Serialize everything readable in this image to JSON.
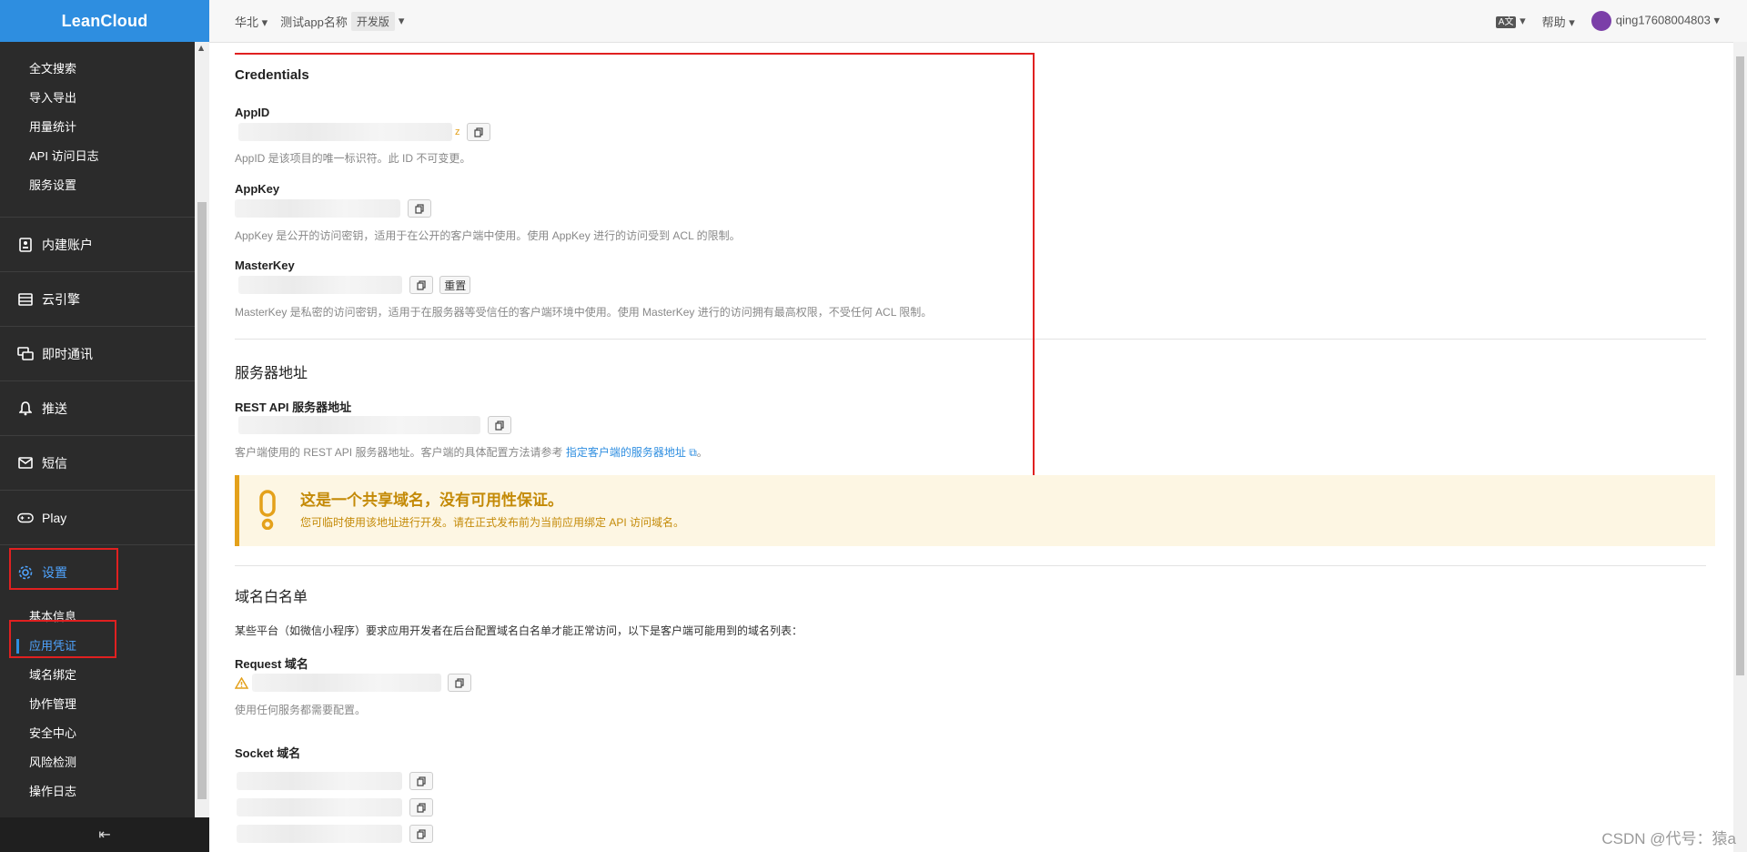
{
  "app": {
    "logo": "LeanCloud"
  },
  "sidebar": {
    "top_items": [
      "全文搜索",
      "导入导出",
      "用量统计",
      "API 访问日志",
      "服务设置"
    ],
    "sections": [
      {
        "label": "内建账户",
        "icon": "user-card-icon"
      },
      {
        "label": "云引擎",
        "icon": "server-icon"
      },
      {
        "label": "即时通讯",
        "icon": "chat-icon"
      },
      {
        "label": "推送",
        "icon": "bell-icon"
      },
      {
        "label": "短信",
        "icon": "mail-icon"
      },
      {
        "label": "Play",
        "icon": "gamepad-icon"
      },
      {
        "label": "设置",
        "icon": "gear-icon"
      }
    ],
    "settings_items": [
      "基本信息",
      "应用凭证",
      "域名绑定",
      "协作管理",
      "安全中心",
      "风险检测",
      "操作日志"
    ],
    "collapse_icon": "⇤"
  },
  "topbar": {
    "region": "华北",
    "app_name": "测试app名称",
    "env_tag": "开发版",
    "lang_icon": "A文",
    "help": "帮助",
    "user": "qing17608004803"
  },
  "credentials": {
    "title": "Credentials",
    "appid_label": "AppID",
    "appid_suffix": "z",
    "appid_help": "AppID 是该项目的唯一标识符。此 ID 不可变更。",
    "appkey_label": "AppKey",
    "appkey_help": "AppKey 是公开的访问密钥，适用于在公开的客户端中使用。使用 AppKey 进行的访问受到 ACL 的限制。",
    "masterkey_label": "MasterKey",
    "reset_label": "重置",
    "masterkey_help": "MasterKey 是私密的访问密钥，适用于在服务器等受信任的客户端环境中使用。使用 MasterKey 进行的访问拥有最高权限，不受任何 ACL 限制。"
  },
  "server": {
    "title": "服务器地址",
    "rest_label": "REST API 服务器地址",
    "rest_help_prefix": "客户端使用的 REST API 服务器地址。客户端的具体配置方法请参考",
    "rest_help_link": "指定客户端的服务器地址",
    "rest_help_suffix": "。"
  },
  "warning": {
    "title": "这是一个共享域名，没有可用性保证。",
    "text": "您可临时使用该地址进行开发。请在正式发布前为当前应用绑定 API 访问域名。"
  },
  "whitelist": {
    "title": "域名白名单",
    "desc": "某些平台（如微信小程序）要求应用开发者在后台配置域名白名单才能正常访问，以下是客户端可能用到的域名列表：",
    "request_label": "Request 域名",
    "request_help": "使用任何服务都需要配置。",
    "socket_label": "Socket 域名"
  },
  "watermark": "CSDN @代号：猿a",
  "colors": {
    "brand": "#2e8ee0",
    "highlight_box": "#e02020",
    "warning": "#c48a07"
  }
}
